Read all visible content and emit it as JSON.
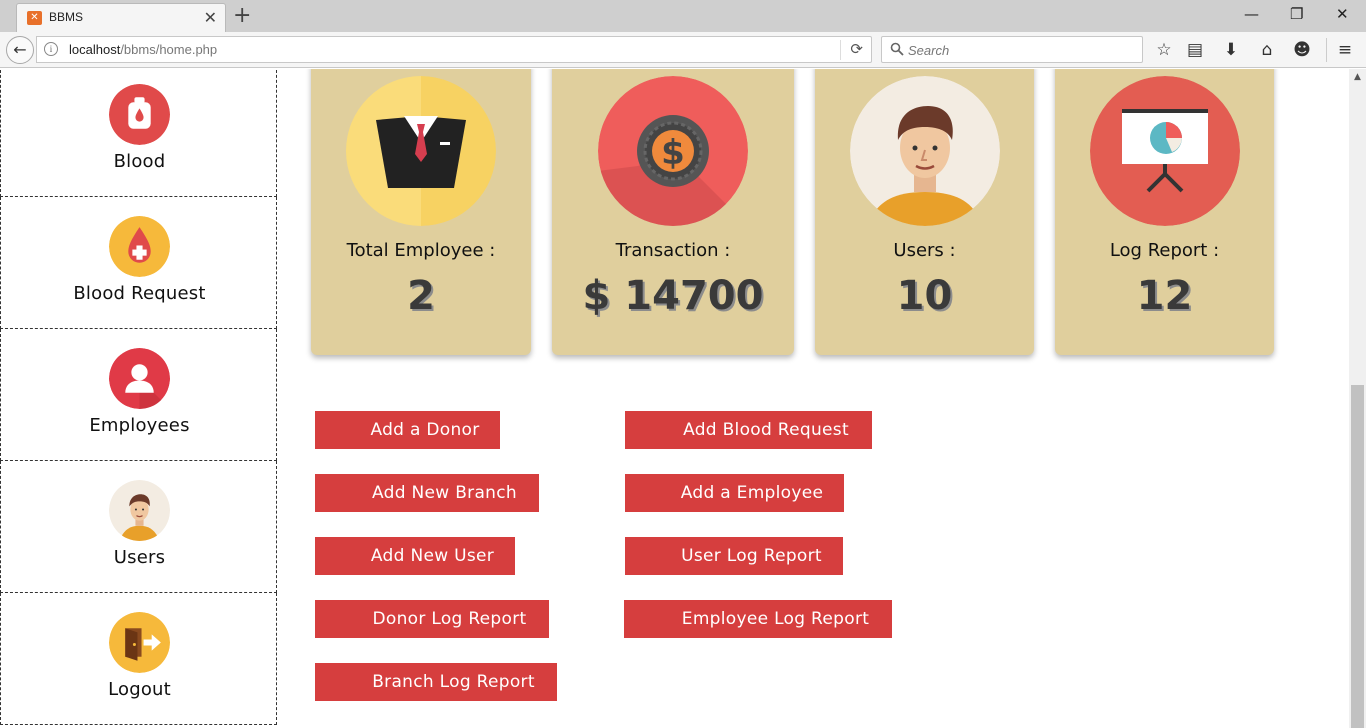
{
  "browser": {
    "tab_title": "BBMS",
    "url_host": "localhost",
    "url_path": "/bbms/home.php",
    "search_placeholder": "Search"
  },
  "sidebar": {
    "items": [
      {
        "label": "Blood",
        "icon": "blood-bag-icon"
      },
      {
        "label": "Blood Request",
        "icon": "blood-drop-plus-icon"
      },
      {
        "label": "Employees",
        "icon": "person-icon"
      },
      {
        "label": "Users",
        "icon": "user-avatar-icon"
      },
      {
        "label": "Logout",
        "icon": "exit-door-icon"
      }
    ]
  },
  "cards": [
    {
      "label": "Total Employee :",
      "value": "2",
      "icon": "suit-icon"
    },
    {
      "label": "Transaction :",
      "value": "$ 14700",
      "icon": "dollar-coin-icon"
    },
    {
      "label": "Users :",
      "value": "10",
      "icon": "man-avatar-icon"
    },
    {
      "label": "Log Report :",
      "value": "12",
      "icon": "presentation-chart-icon"
    }
  ],
  "actions": [
    "Add a Donor",
    "Add Blood Request",
    "Add New Branch",
    "Add a Employee",
    "Add New User",
    "User Log Report",
    "Donor Log Report",
    "Employee Log Report",
    "Branch Log Report"
  ],
  "colors": {
    "card_bg": "#e0cf9d",
    "button_bg": "#d63e3e",
    "red_icon": "#e04a4a",
    "yellow_icon": "#f6b93b"
  }
}
